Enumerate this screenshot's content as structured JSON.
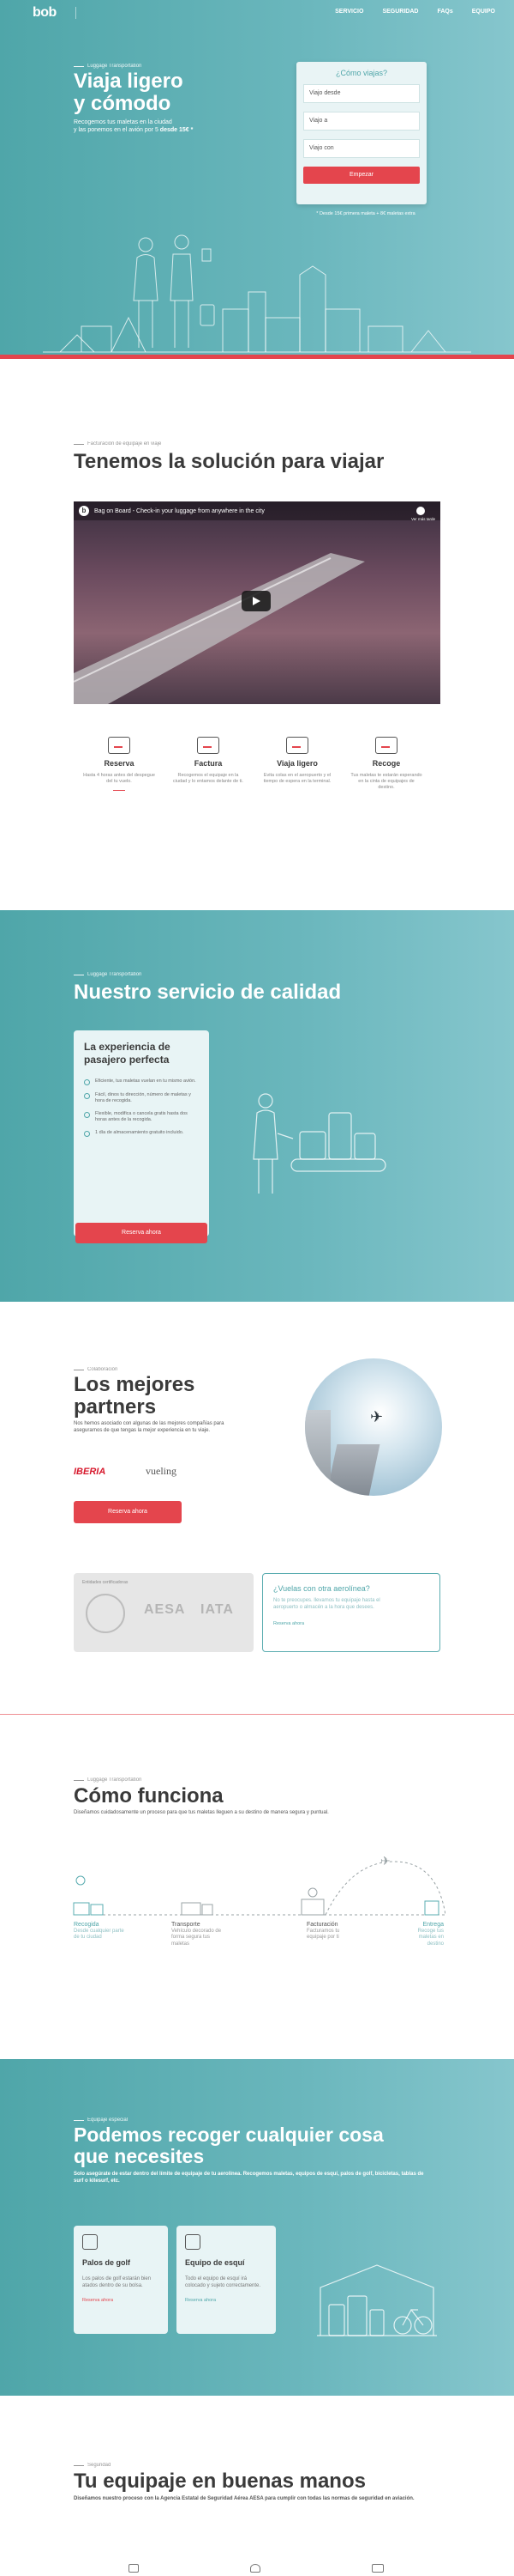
{
  "colors": {
    "teal": "#5aacb0",
    "red": "#e4454d",
    "card": "#e8f4f5",
    "iberia": "#d7192d"
  },
  "nav": {
    "logo": "bob",
    "links": [
      "SERVICIO",
      "SEGURIDAD",
      "FAQs",
      "EQUIPO"
    ]
  },
  "hero": {
    "eyebrow": "Luggage Transportation",
    "title_l1": "Viaja ligero",
    "title_l2": "y cómodo",
    "sub_l1": "Recogemos tus maletas en la ciudad",
    "sub_l2": "y las ponemos en el avión por 5",
    "sub_l2b": "desde 15€ *",
    "form": {
      "title": "¿Cómo viajas?",
      "from_placeholder": "Viajo desde",
      "to_placeholder": "Viajo a",
      "with_placeholder": "Viajo con",
      "button": "Empezar",
      "footnote": "* Desde 15€ primera maleta + 8€ maletas extra"
    }
  },
  "solution": {
    "eyebrow": "Facturación de equipaje en viaje",
    "title": "Tenemos la solución para viajar",
    "video": {
      "title": "Bag on Board - Check-in your luggage from anywhere in the city",
      "watch_later": "Ver más tarde"
    },
    "features": [
      {
        "title": "Reserva",
        "desc": "Hasta 4 horas antes del despegue del tu vuelo."
      },
      {
        "title": "Factura",
        "desc": "Recogemos el equipaje en la ciudad y lo entamos delante de ti."
      },
      {
        "title": "Viaja ligero",
        "desc": "Evita colas en el aeropuerto y el tiempo de espera en la terminal."
      },
      {
        "title": "Recoge",
        "desc": "Tus maletas te estarán esperando en la cinta de equipajes de destino."
      }
    ]
  },
  "quality": {
    "eyebrow": "Luggage Transportation",
    "title": "Nuestro servicio de calidad",
    "card_title_l1": "La experiencia de",
    "card_title_l2": "pasajero perfecta",
    "items": [
      "Eficiente, tus maletas vuelan en tu mismo avión.",
      "Fácil, dinos tu dirección, número de maletas y hora de recogida.",
      "Flexible, modifica o cancela gratis hasta dos horas antes de la recogida.",
      "1 día de almacenamiento gratuito incluido."
    ],
    "button": "Reserva ahora"
  },
  "partners": {
    "eyebrow": "Colaboración",
    "title_l1": "Los mejores",
    "title_l2": "partners",
    "desc": "Nos hemos asociado con algunas de las mejores compañías para asegurarnos de que tengas la mejor experiencia en tu viaje.",
    "logos": [
      "IBERIA",
      "vueling"
    ],
    "button": "Reserva ahora",
    "cert_caption": "Entidades certificadoras",
    "cert_logos": [
      "AESA",
      "IATA"
    ],
    "other_title": "¿Vuelas con otra aerolínea?",
    "other_desc": "No te preocupes. llevamos tu equipaje hasta el aeropuerto o almacén a la hora que desees.",
    "other_link": "Reserva ahora"
  },
  "how": {
    "eyebrow": "Luggage Transportation",
    "title": "Cómo funciona",
    "desc": "Diseñamos cuidadosamente un proceso para que tus maletas lleguen a su destino de manera segura y puntual.",
    "steps": [
      {
        "title": "Recogida",
        "desc": "Desde cualquier parte de tu ciudad"
      },
      {
        "title": "Transporte",
        "desc": "Vehículo decorado de forma segura tus maletas"
      },
      {
        "title": "Facturación",
        "desc": "Facturamos tu equipaje por ti"
      },
      {
        "title": "Entrega",
        "desc": "Recoge tus maletas en destino"
      }
    ]
  },
  "special": {
    "eyebrow": "Equipaje especial",
    "title_l1": "Podemos recoger cualquier cosa",
    "title_l2": "que necesites",
    "desc": "Solo asegúrate de estar dentro del límite de equipaje de tu aerolínea. Recogemos maletas, equipos de esquí, palos de golf, bicicletas, tablas de surf o kitesurf, etc.",
    "cards": [
      {
        "title": "Palos de golf",
        "desc": "Los palos de golf estarán bien atados dentro de su bolsa.",
        "link": "Reserva ahora"
      },
      {
        "title": "Equipo de esquí",
        "desc": "Todo el equipo de esquí irá colocado y sujeto correctamente.",
        "link": "Reserva ahora"
      }
    ]
  },
  "safety": {
    "eyebrow": "Seguridad",
    "title": "Tu equipaje en buenas manos",
    "desc": "Diseñamos nuestro proceso con la Agencia Estatal de Seguridad Aérea AESA para cumplir con todas las normas de seguridad en aviación."
  }
}
